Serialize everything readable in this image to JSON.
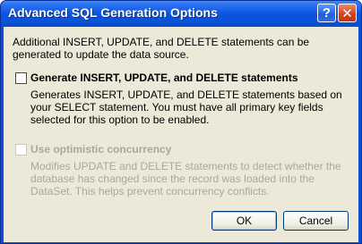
{
  "window": {
    "title": "Advanced SQL Generation Options"
  },
  "content": {
    "intro": "Additional INSERT, UPDATE, and DELETE statements can be generated to update the data source.",
    "option_generate": {
      "label": "Generate INSERT, UPDATE, and DELETE statements",
      "checked": false,
      "enabled": true,
      "description": "Generates INSERT, UPDATE, and DELETE statements based on your SELECT statement. You must have all primary key fields selected for this option to be enabled."
    },
    "option_optimistic": {
      "label": "Use optimistic concurrency",
      "checked": false,
      "enabled": false,
      "description": "Modifies UPDATE and DELETE statements to detect whether the database has changed since the record was loaded into the DataSet. This helps prevent concurrency conflicts."
    }
  },
  "buttons": {
    "ok": "OK",
    "cancel": "Cancel"
  },
  "titlebar_buttons": {
    "help": "?",
    "close": "✕"
  },
  "colors": {
    "titlebar": "#0a55e0",
    "dialog_bg": "#ece9d8",
    "disabled_text": "#aca899"
  }
}
